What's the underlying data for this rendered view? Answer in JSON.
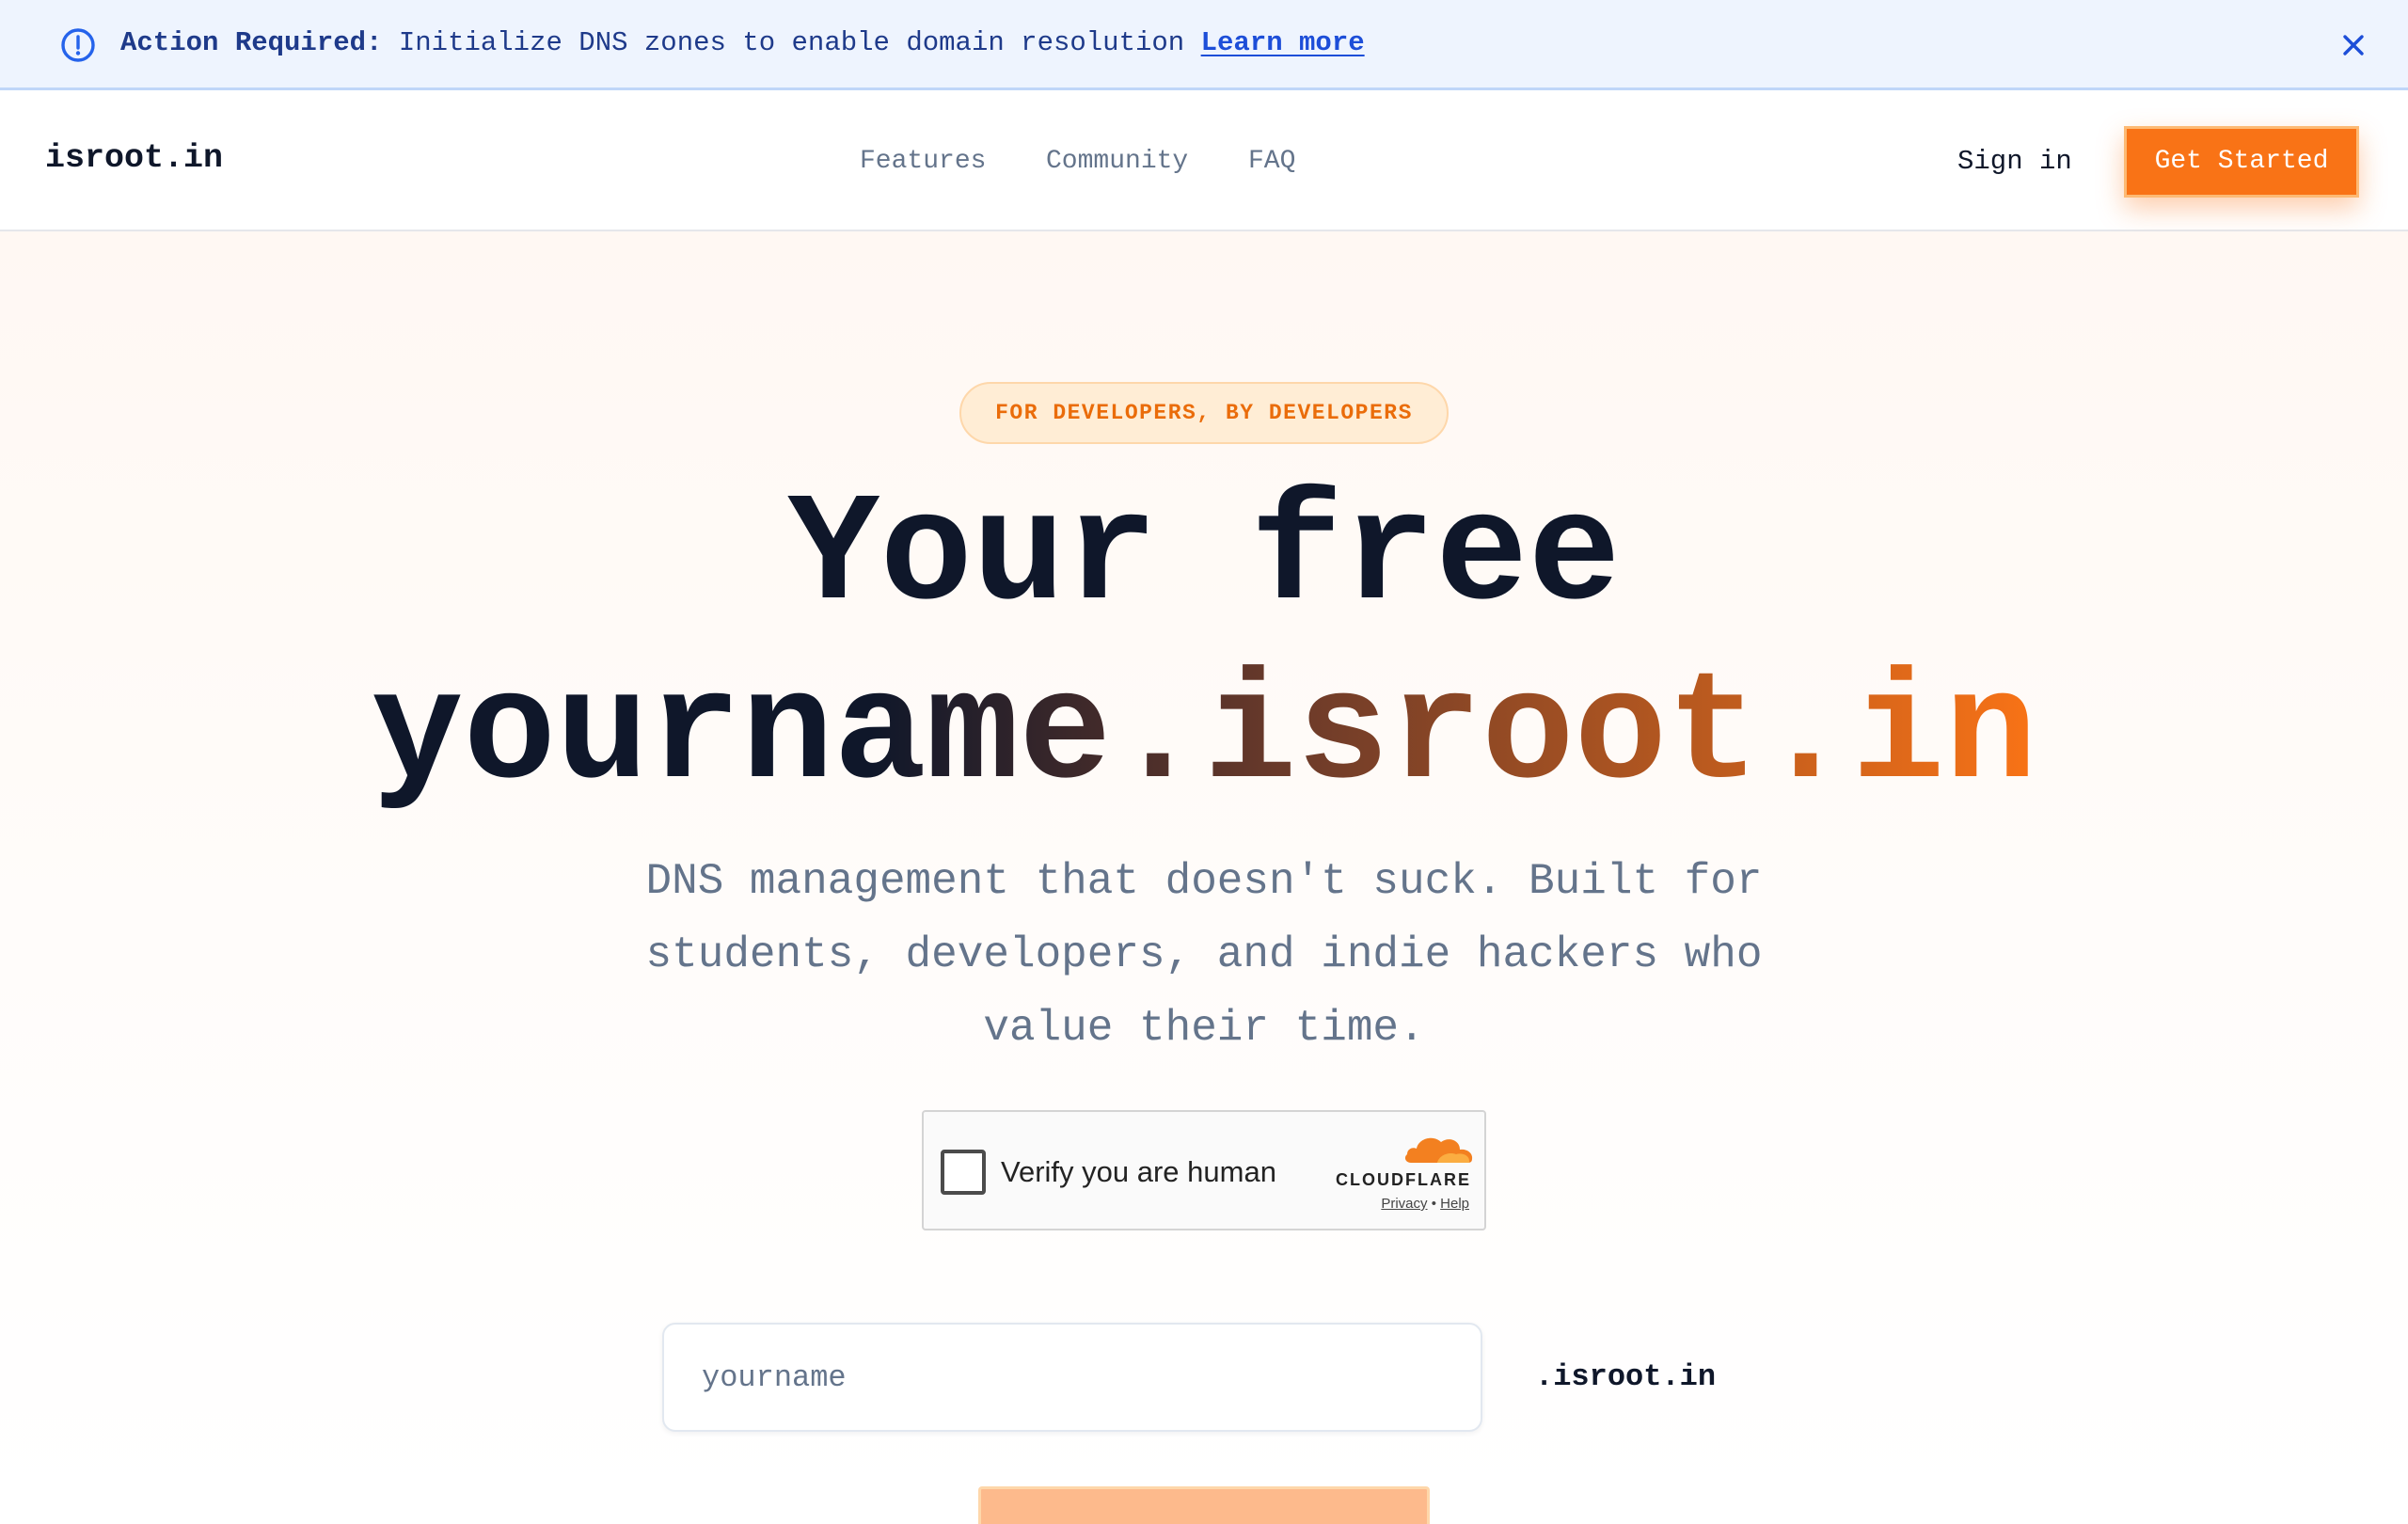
{
  "alert": {
    "title": "Action Required:",
    "message": "Initialize DNS zones to enable domain resolution",
    "link_label": "Learn more",
    "icon": "exclamation-circle-icon",
    "close_icon": "close-icon"
  },
  "header": {
    "logo": "isroot.in",
    "nav": [
      {
        "label": "Features"
      },
      {
        "label": "Community"
      },
      {
        "label": "FAQ"
      }
    ],
    "signin_label": "Sign in",
    "cta_label": "Get Started"
  },
  "hero": {
    "badge": "FOR DEVELOPERS, BY DEVELOPERS",
    "title_line1": "Your free",
    "title_line2": "yourname.isroot.in",
    "subtitle": "DNS management that doesn't suck. Built for students, developers, and indie hackers who value their time."
  },
  "captcha": {
    "label": "Verify you are human",
    "brand": "CLOUDFLARE",
    "privacy": "Privacy",
    "separator": "•",
    "help": "Help"
  },
  "domain_form": {
    "placeholder": "yourname",
    "value": "",
    "suffix": ".isroot.in"
  },
  "colors": {
    "accent": "#f97316",
    "alert_bg": "#eef4fe",
    "alert_text": "#1e3a8a",
    "heading": "#0f172a",
    "muted": "#64748b"
  }
}
